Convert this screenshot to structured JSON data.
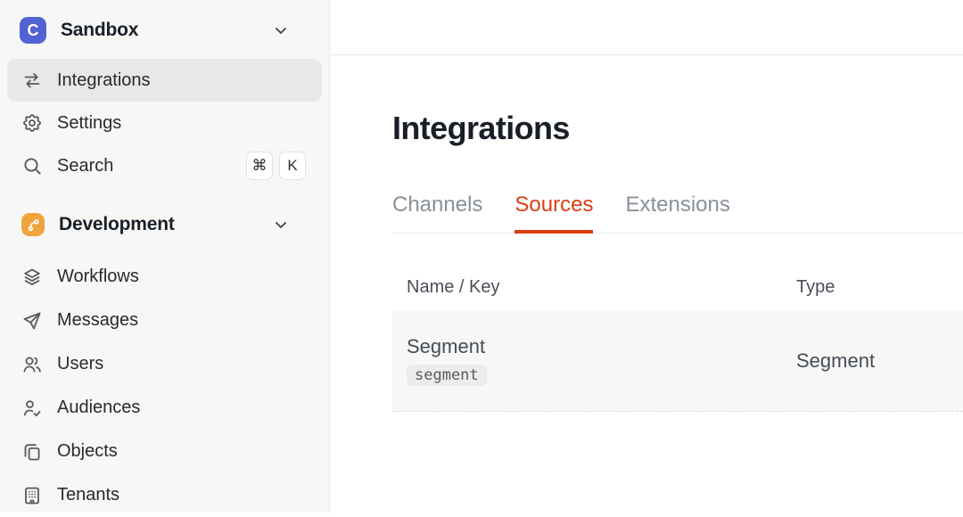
{
  "workspace": {
    "name": "Sandbox",
    "logo_letter": "C"
  },
  "sidebar": {
    "items_top": [
      {
        "label": "Integrations",
        "icon": "swap-arrows-icon",
        "active": true
      },
      {
        "label": "Settings",
        "icon": "gear-icon",
        "active": false
      },
      {
        "label": "Search",
        "icon": "search-icon",
        "active": false,
        "shortcut_keys": [
          "⌘",
          "K"
        ]
      }
    ],
    "section": {
      "label": "Development",
      "icon": "branch-icon"
    },
    "items_dev": [
      {
        "label": "Workflows",
        "icon": "layers-icon"
      },
      {
        "label": "Messages",
        "icon": "paper-plane-icon"
      },
      {
        "label": "Users",
        "icon": "users-icon"
      },
      {
        "label": "Audiences",
        "icon": "person-check-icon"
      },
      {
        "label": "Objects",
        "icon": "copy-icon"
      },
      {
        "label": "Tenants",
        "icon": "building-icon"
      }
    ]
  },
  "main": {
    "title": "Integrations",
    "tabs": [
      {
        "label": "Channels",
        "active": false
      },
      {
        "label": "Sources",
        "active": true
      },
      {
        "label": "Extensions",
        "active": false
      }
    ],
    "table": {
      "columns": [
        "Name / Key",
        "Type"
      ],
      "rows": [
        {
          "name": "Segment",
          "key": "segment",
          "type": "Segment"
        }
      ]
    }
  },
  "colors": {
    "accent": "#DC3D13",
    "logo_bg": "#5163D2",
    "dev_icon_bg": "#EFA43E",
    "sidebar_bg": "#F7F7F5",
    "active_item_bg": "#E9E8E7",
    "row_bg": "#F7F7F5",
    "chip_bg": "#ECECEA"
  }
}
